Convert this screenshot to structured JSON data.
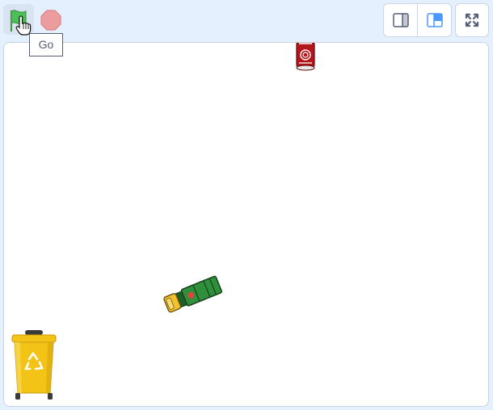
{
  "toolbar": {
    "green_flag": {
      "icon": "green-flag-icon",
      "color": "#4cbf56"
    },
    "stop": {
      "icon": "stop-sign-icon",
      "color": "#ec9c9c"
    },
    "tooltip_text": "Go",
    "layout_buttons": [
      {
        "icon": "small-stage-icon",
        "active": false
      },
      {
        "icon": "normal-stage-icon",
        "active": true
      }
    ],
    "fullscreen": {
      "icon": "fullscreen-icon"
    }
  },
  "stage": {
    "background": "#ffffff",
    "sprites": [
      {
        "name": "red-can-sprite",
        "color": "#b5161b"
      },
      {
        "name": "garbage-truck-sprite",
        "color": "#2f8f3a"
      },
      {
        "name": "recycle-bin-sprite",
        "color": "#f3c316"
      }
    ]
  },
  "colors": {
    "accent": "#4c97ff",
    "toolbar_bg": "#e5f0ff",
    "border": "#cbd5e3"
  }
}
